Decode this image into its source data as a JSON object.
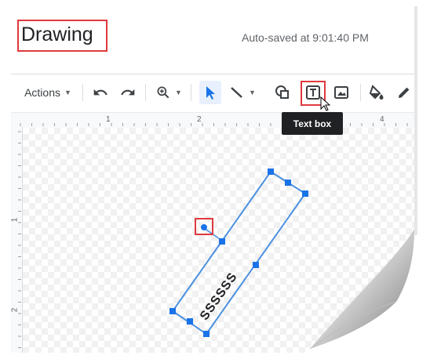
{
  "header": {
    "title": "Drawing",
    "autosave": "Auto-saved at 9:01:40 PM"
  },
  "toolbar": {
    "actions_label": "Actions",
    "tools": [
      {
        "name": "undo-icon"
      },
      {
        "name": "redo-icon"
      },
      {
        "name": "zoom-icon"
      },
      {
        "name": "select-arrow-icon"
      },
      {
        "name": "line-icon"
      },
      {
        "name": "shape-icon"
      },
      {
        "name": "text-box-icon"
      },
      {
        "name": "image-icon"
      },
      {
        "name": "fill-color-icon"
      },
      {
        "name": "pen-icon"
      }
    ],
    "tooltip": "Text box"
  },
  "rulers": {
    "horizontal_labels": [
      "1",
      "2",
      "4"
    ],
    "vertical_labels": [
      "1",
      "2"
    ]
  },
  "canvas": {
    "text_box_content": "SSSSSS"
  },
  "colors": {
    "highlight": "#e0393e",
    "selection": "#4a90e2",
    "handle": "#1a73e8"
  }
}
